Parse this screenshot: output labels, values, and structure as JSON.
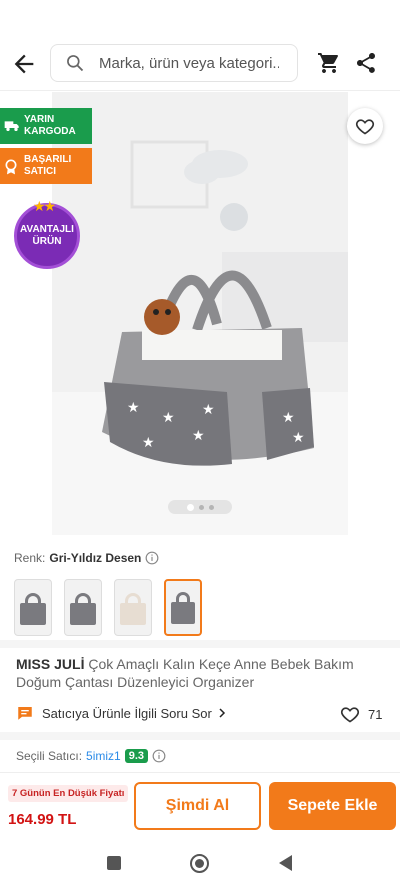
{
  "search": {
    "placeholder": "Marka, ürün veya kategori..."
  },
  "badges": {
    "delivery": "YARIN KARGODA",
    "seller": "BAŞARILI SATICI",
    "advantage_line1": "AVANTAJLI",
    "advantage_line2": "ÜRÜN"
  },
  "gallery": {
    "current_index": 1,
    "total": 3
  },
  "color": {
    "label": "Renk:",
    "value": "Gri-Yıldız Desen"
  },
  "product": {
    "brand": "MISS JULİ",
    "name": "Çok Amaçlı Kalın Keçe Anne Bebek Bakım Doğum Çantası Düzenleyici Organizer"
  },
  "ask_seller": "Satıcıya Ürünle İlgili Soru Sor",
  "favorites_count": "71",
  "seller": {
    "label": "Seçili Satıcı:",
    "name": "5imiz1",
    "score": "9.3"
  },
  "bottom": {
    "lowest_price_note": "7 Günün En Düşük Fiyatı",
    "price": "164.99 TL",
    "buy_now": "Şimdi Al",
    "add_to_cart": "Sepete Ekle"
  },
  "colors": {
    "accent": "#f27a1a",
    "green": "#1a9c4c",
    "price_red": "#d21313",
    "link": "#2b8be8",
    "purple": "#7b2bb5"
  },
  "icons": [
    "back-arrow-icon",
    "search-icon",
    "cart-icon",
    "share-icon",
    "heart-icon",
    "truck-icon",
    "award-icon",
    "info-icon",
    "chat-icon",
    "chevron-right-icon"
  ]
}
